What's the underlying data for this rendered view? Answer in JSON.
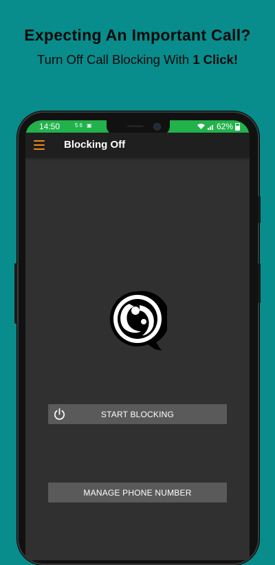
{
  "promo": {
    "title": "Expecting An Important Call?",
    "subtitle_prefix": "Turn Off Call Blocking With ",
    "subtitle_bold": "1 Click!"
  },
  "status_bar": {
    "time": "14:50",
    "small_icons": "56 ▣",
    "battery_percent": "62%"
  },
  "app_bar": {
    "title": "Blocking Off",
    "menu_icon": "hamburger-menu-icon"
  },
  "main": {
    "logo_icon": "call-blocker-logo-icon",
    "start_button_label": "START BLOCKING",
    "start_button_icon": "power-icon",
    "manage_button_label": "MANAGE PHONE NUMBER"
  },
  "colors": {
    "background": "#088C8C",
    "status_bar": "#22B24C",
    "app_bar": "#1F1F1F",
    "screen": "#303030",
    "button": "#5A5A5A",
    "menu_accent": "#F08A1E"
  }
}
